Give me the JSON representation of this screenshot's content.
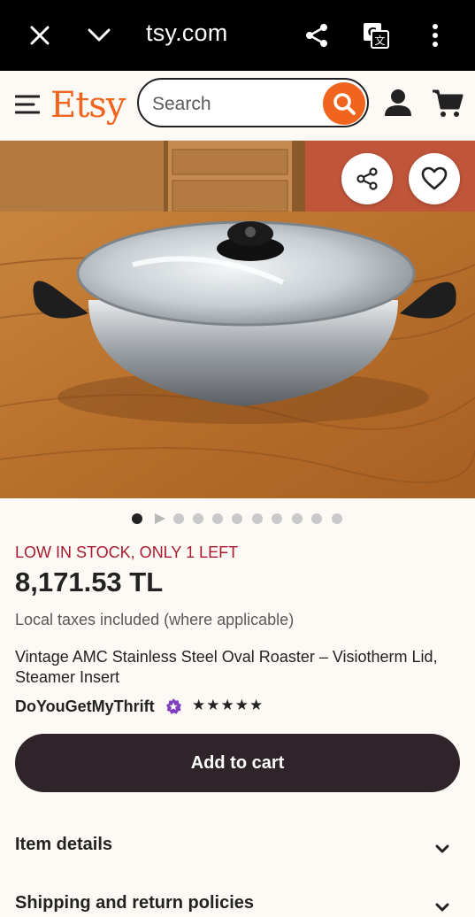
{
  "browser": {
    "url": "tsy.com"
  },
  "header": {
    "logo": "Etsy",
    "search_placeholder": "Search"
  },
  "carousel": {
    "total_images": 11,
    "current_index": 1
  },
  "product": {
    "stock_notice": "LOW IN STOCK, ONLY 1 LEFT",
    "price": "8,171.53 TL",
    "tax_note": "Local taxes included (where applicable)",
    "title": "Vintage AMC Stainless Steel Oval Roaster – Visiotherm Lid, Steamer Insert",
    "shop_name": "DoYouGetMyThrift",
    "rating": 5,
    "stars": "★★★★★",
    "add_to_cart": "Add to cart"
  },
  "sections": [
    {
      "label": "Item details"
    },
    {
      "label": "Shipping and return policies"
    }
  ],
  "colors": {
    "brand": "#f1641e",
    "stock_red": "#a61a2e",
    "cart_button": "#2e2429",
    "star_seller": "#7f3fbf"
  }
}
